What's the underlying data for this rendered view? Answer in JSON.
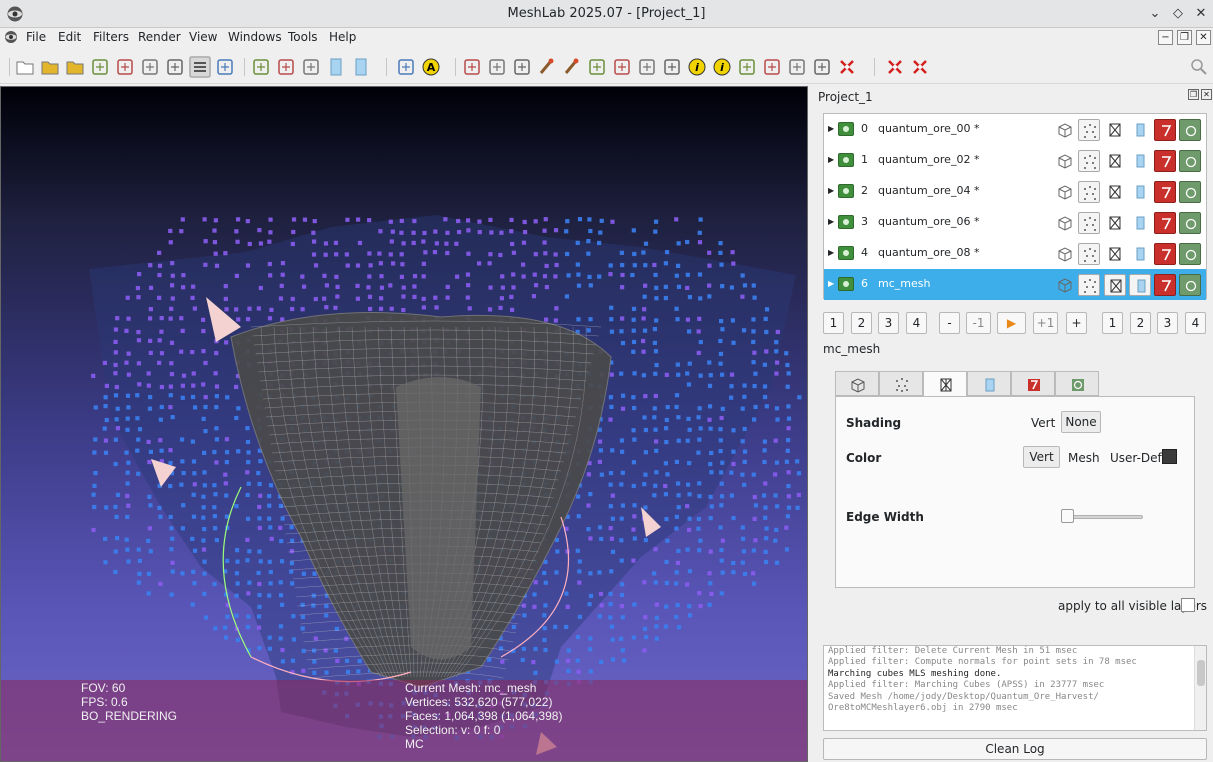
{
  "window": {
    "title": "MeshLab 2025.07 - [Project_1]",
    "controls": [
      "⌄",
      "◇",
      "✕"
    ]
  },
  "menu": {
    "items": [
      "File",
      "Edit",
      "Filters",
      "Render",
      "View",
      "Windows",
      "Tools",
      "Help"
    ],
    "mdi_controls": [
      "−",
      "❐",
      "✕"
    ]
  },
  "toolbar": {
    "icons": [
      "new-project-icon",
      "open-project-icon",
      "open-mesh-icon",
      "reload-icon",
      "reload-all-icon",
      "save-icon",
      "snapshot-icon",
      "layers-icon",
      "light-icon",
      "bbox-icon",
      "points-icon",
      "wireframe-icon",
      "flat-icon",
      "smooth-icon",
      "sphere-icon",
      "measure-icon",
      "color-icon",
      "align-icon",
      "axis-icon",
      "paint-icon",
      "brush-icon",
      "select-icon",
      "vertex-select-icon",
      "face-select-icon",
      "move-icon",
      "ruler-icon",
      "info-icon",
      "texture-icon",
      "paintbrush-icon",
      "pick-icon",
      "point-icon",
      "delete-face-icon",
      "delete-vertex-icon",
      "delete-all-icon",
      "search-icon"
    ]
  },
  "viewport": {
    "info_left": [
      "FOV: 60",
      "FPS:     0.6",
      "BO_RENDERING"
    ],
    "info_mid": [
      "Current Mesh: mc_mesh",
      "Vertices: 532,620     (577,022)",
      "Faces: 1,064,398     (1,064,398)",
      "Selection: v: 0 f: 0",
      "MC"
    ]
  },
  "panel": {
    "title": "Project_1",
    "layers": [
      {
        "num": "0",
        "name": "quantum_ore_00 *",
        "selected": false
      },
      {
        "num": "1",
        "name": "quantum_ore_02 *",
        "selected": false
      },
      {
        "num": "2",
        "name": "quantum_ore_04 *",
        "selected": false
      },
      {
        "num": "3",
        "name": "quantum_ore_06 *",
        "selected": false
      },
      {
        "num": "4",
        "name": "quantum_ore_08 *",
        "selected": false
      },
      {
        "num": "6",
        "name": "mc_mesh",
        "selected": true
      }
    ],
    "layer_buttons_left": [
      "1",
      "2",
      "3",
      "4"
    ],
    "layer_buttons_mid": [
      "-",
      "-1",
      "▶",
      "+1",
      "+"
    ],
    "layer_buttons_right": [
      "1",
      "2",
      "3",
      "4"
    ],
    "mesh_label": "mc_mesh",
    "shading_label": "Shading",
    "shading_options": [
      "Vert",
      "None"
    ],
    "color_label": "Color",
    "color_options": [
      "Vert",
      "Mesh",
      "User-Def"
    ],
    "edge_width_label": "Edge Width",
    "edge_width_value": 0,
    "apply_all": "apply to all visible layers",
    "log": [
      {
        "text": "Applied filter: Delete Current Mesh in 51 msec",
        "dark": false
      },
      {
        "text": "Applied filter: Compute normals for point sets in 78 msec",
        "dark": false
      },
      {
        "text": "  Marching cubes MLS meshing done.",
        "dark": true
      },
      {
        "text": "Applied filter: Marching Cubes (APSS) in 23777 msec",
        "dark": false
      },
      {
        "text": "Saved Mesh /home/jody/Desktop/Quantum_Ore_Harvest/",
        "dark": false
      },
      {
        "text": "Ore8toMCMeshlayer6.obj in 2790 msec",
        "dark": false
      }
    ],
    "clean_log": "Clean Log"
  },
  "colors": {
    "selection": "#3daee9",
    "point_blue": "#3b7ff0",
    "point_violet": "#8a5cf0",
    "mesh_grey": "#4a4a4a"
  }
}
